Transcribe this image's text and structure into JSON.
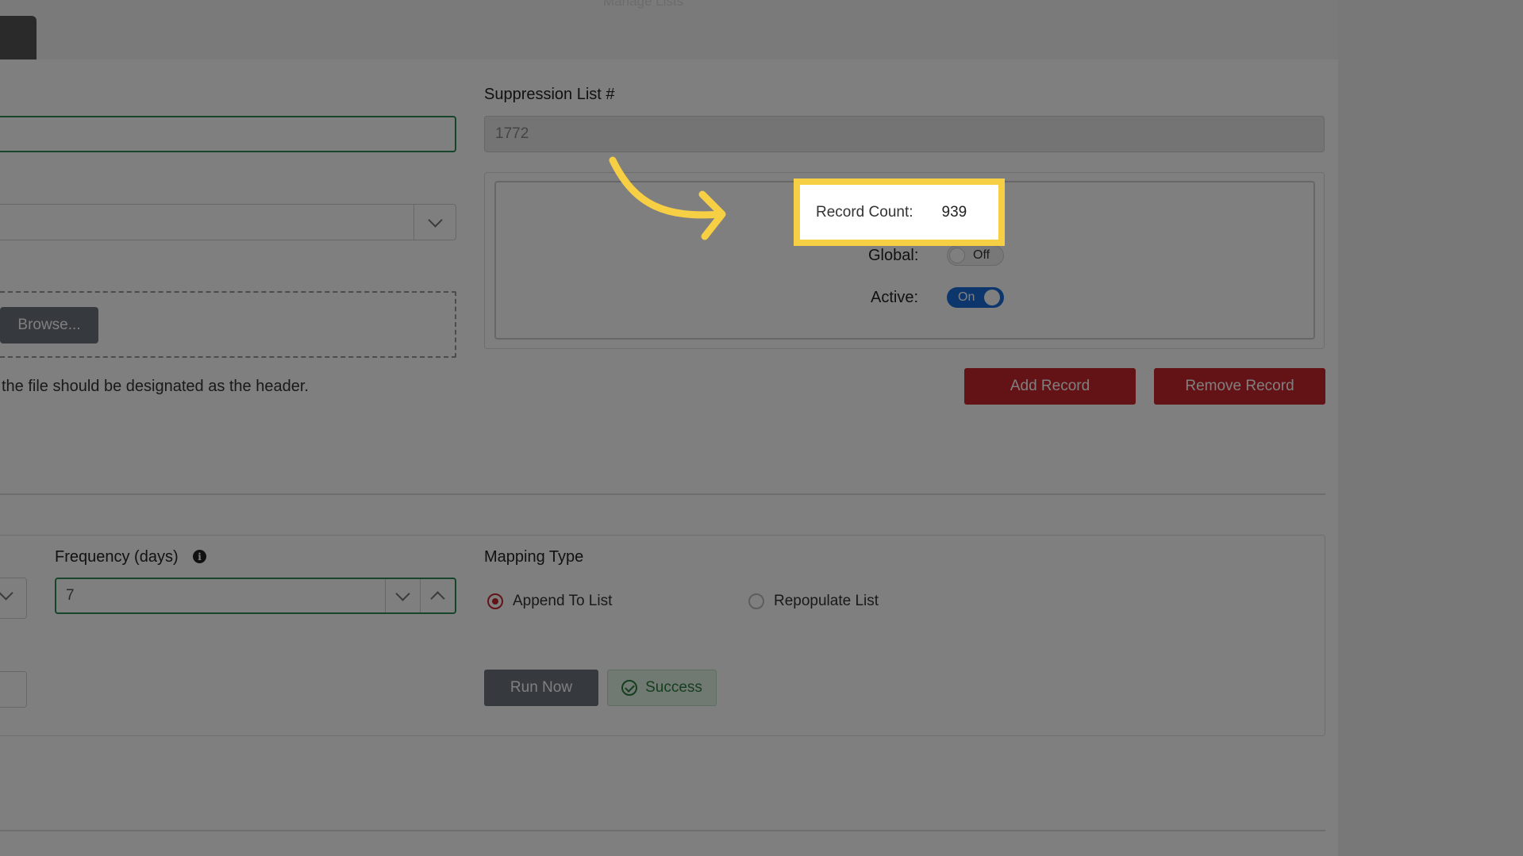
{
  "header": {
    "ghost_text": "Manage Lists"
  },
  "form": {
    "suppression_list_label": "Suppression List #",
    "suppression_list_value": "1772",
    "browse_button": "Browse...",
    "header_hint": "the file should be designated as the header."
  },
  "stats": {
    "record_count_label": "Record Count:",
    "record_count_value": "939",
    "global_label": "Global:",
    "global_state": "Off",
    "active_label": "Active:",
    "active_state": "On"
  },
  "actions": {
    "add_record": "Add Record",
    "remove_record": "Remove Record"
  },
  "schedule": {
    "frequency_label": "Frequency (days)",
    "frequency_value": "7",
    "info_icon": "i",
    "mapping_type_label": "Mapping Type",
    "mapping_options": [
      "Append To List",
      "Repopulate List"
    ],
    "mapping_selected": "Append To List",
    "run_now": "Run Now",
    "status": "Success"
  },
  "overlay": {
    "annotation": "arrow-callout",
    "highlight_color": "#f7cf44"
  }
}
